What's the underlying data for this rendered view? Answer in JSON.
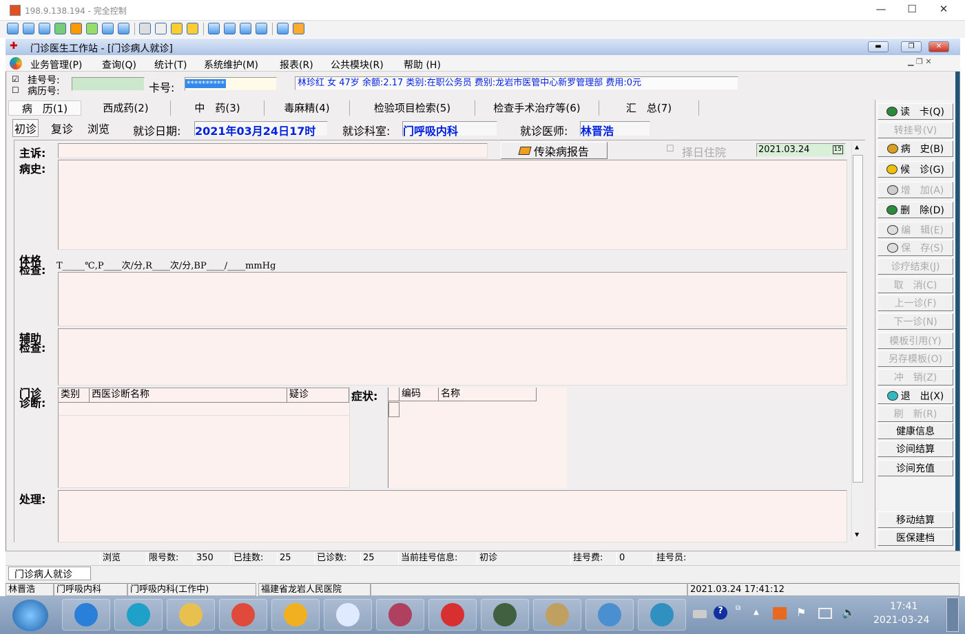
{
  "remote": {
    "title": "198.9.138.194 - 完全控制",
    "min": "—",
    "max": "☐",
    "close": "✕"
  },
  "app": {
    "title": "门诊医生工作站 - [门诊病人就诊]"
  },
  "menu": [
    "业务管理(P)",
    "查询(Q)",
    "统计(T)",
    "系统维护(M)",
    "报表(R)",
    "公共模块(R)",
    "帮助 (H)"
  ],
  "patient_bar": {
    "reg_no_label": "挂号号:",
    "record_no_label": "病历号:",
    "reg_checked": true,
    "card_label": "卡号:",
    "card_value": "**********",
    "info": "林珍红 女 47岁 余额:2.17 类别:在职公务员 费别:龙岩市医管中心新罗管理部 费用:0元"
  },
  "tabs": [
    "病　历(1)",
    "西成药(2)",
    "中　药(3)",
    "毒麻精(4)",
    "检验项目检索(5)",
    "检查手术治疗等(6)",
    "汇　总(7)"
  ],
  "visit_tabs": [
    "初诊",
    "复诊",
    "浏览"
  ],
  "visit": {
    "date_label": "就诊日期:",
    "date": "2021年03月24日17时",
    "dept_label": "就诊科室:",
    "dept": "门呼吸内科",
    "doctor_label": "就诊医师:",
    "doctor": "林晋浩"
  },
  "form": {
    "complaint_label": "主诉:",
    "history_label": "病史:",
    "infect_btn": "传染病报告",
    "admit_label": "择日住院",
    "admit_date": "2021.03.24",
    "cal": "15",
    "exam_label1": "体格",
    "exam_label2": "检查:",
    "vitals": "T_____℃,P____次/分,R____次/分,BP____/____mmHg",
    "aux_label1": "辅助",
    "aux_label2": "检查:",
    "diag_label1": "门诊",
    "diag_label2": "诊断:",
    "diag_cols": [
      "类别",
      "西医诊断名称",
      "疑诊"
    ],
    "symptom_label": "症状:",
    "symptom_cols": [
      "编码",
      "名称"
    ],
    "treat_label": "处理:"
  },
  "buttons": [
    {
      "label": "读　卡(Q)",
      "enabled": true,
      "icon": "card-reader-icon",
      "color": "#2a8a3a"
    },
    {
      "label": "转挂号(V)",
      "enabled": false
    },
    {
      "label": "病　史(B)",
      "enabled": true,
      "icon": "history-icon",
      "color": "#d9a020"
    },
    {
      "label": "候　诊(G)",
      "enabled": true,
      "icon": "clock-icon",
      "color": "#f0c000"
    },
    {
      "label": "增　加(A)",
      "enabled": false,
      "icon": "add-icon",
      "color": "#ccc"
    },
    {
      "label": "删　除(D)",
      "enabled": true,
      "icon": "delete-icon",
      "color": "#2a8a3a"
    },
    {
      "label": "编　辑(E)",
      "enabled": false,
      "icon": "edit-icon",
      "color": "#ddd"
    },
    {
      "label": "保　存(S)",
      "enabled": false,
      "icon": "save-icon",
      "color": "#ddd"
    },
    {
      "label": "诊疗结束(J)",
      "enabled": false
    },
    {
      "label": "取　消(C)",
      "enabled": false
    },
    {
      "label": "上一诊(F)",
      "enabled": false
    },
    {
      "label": "下一诊(N)",
      "enabled": false
    },
    {
      "label": "模板引用(Y)",
      "enabled": false
    },
    {
      "label": "另存模板(O)",
      "enabled": false
    },
    {
      "label": "冲　销(Z)",
      "enabled": false
    },
    {
      "label": "退　出(X)",
      "enabled": true,
      "icon": "exit-icon",
      "color": "#30b8c0"
    },
    {
      "label": "刷　新(R)",
      "enabled": false
    },
    {
      "label": "健康信息",
      "enabled": true
    },
    {
      "label": "诊间结算",
      "enabled": true
    },
    {
      "label": "诊间充值",
      "enabled": true
    },
    {
      "label": "移动结算",
      "enabled": true
    },
    {
      "label": "医保建档",
      "enabled": true
    }
  ],
  "status": {
    "mode": "浏览",
    "limit_label": "限号数:",
    "limit": "350",
    "reg_label": "已挂数:",
    "reg": "25",
    "seen_label": "已诊数:",
    "seen": "25",
    "cur_label": "当前挂号信息:",
    "cur": "初诊",
    "fee_label": "挂号费:",
    "fee": "0",
    "clerk_label": "挂号员:"
  },
  "doc_tab": "门诊病人就诊",
  "bottom": {
    "doctor": "林晋浩",
    "dept": "门呼吸内科",
    "dept_status": "门呼吸内科(工作中)",
    "hospital": "福建省龙岩人民医院",
    "datetime": "2021.03.24 17:41:12"
  },
  "taskbar": {
    "time": "17:41",
    "date": "2021-03-24",
    "apps": [
      {
        "name": "ie",
        "color": "#2a7fd8"
      },
      {
        "name": "edge",
        "color": "#1fa0c8"
      },
      {
        "name": "explorer",
        "color": "#e8c050"
      },
      {
        "name": "chrome",
        "color": "#e04a3a"
      },
      {
        "name": "sql",
        "color": "#f0b020"
      },
      {
        "name": "app",
        "color": "#e0eaff"
      },
      {
        "name": "database",
        "color": "#b04060"
      },
      {
        "name": "snail",
        "color": "#d83030"
      },
      {
        "name": "monitor",
        "color": "#406040"
      },
      {
        "name": "user",
        "color": "#c0a060"
      },
      {
        "name": "network",
        "color": "#4a90d0"
      },
      {
        "name": "remote",
        "color": "#3090c0"
      }
    ]
  }
}
